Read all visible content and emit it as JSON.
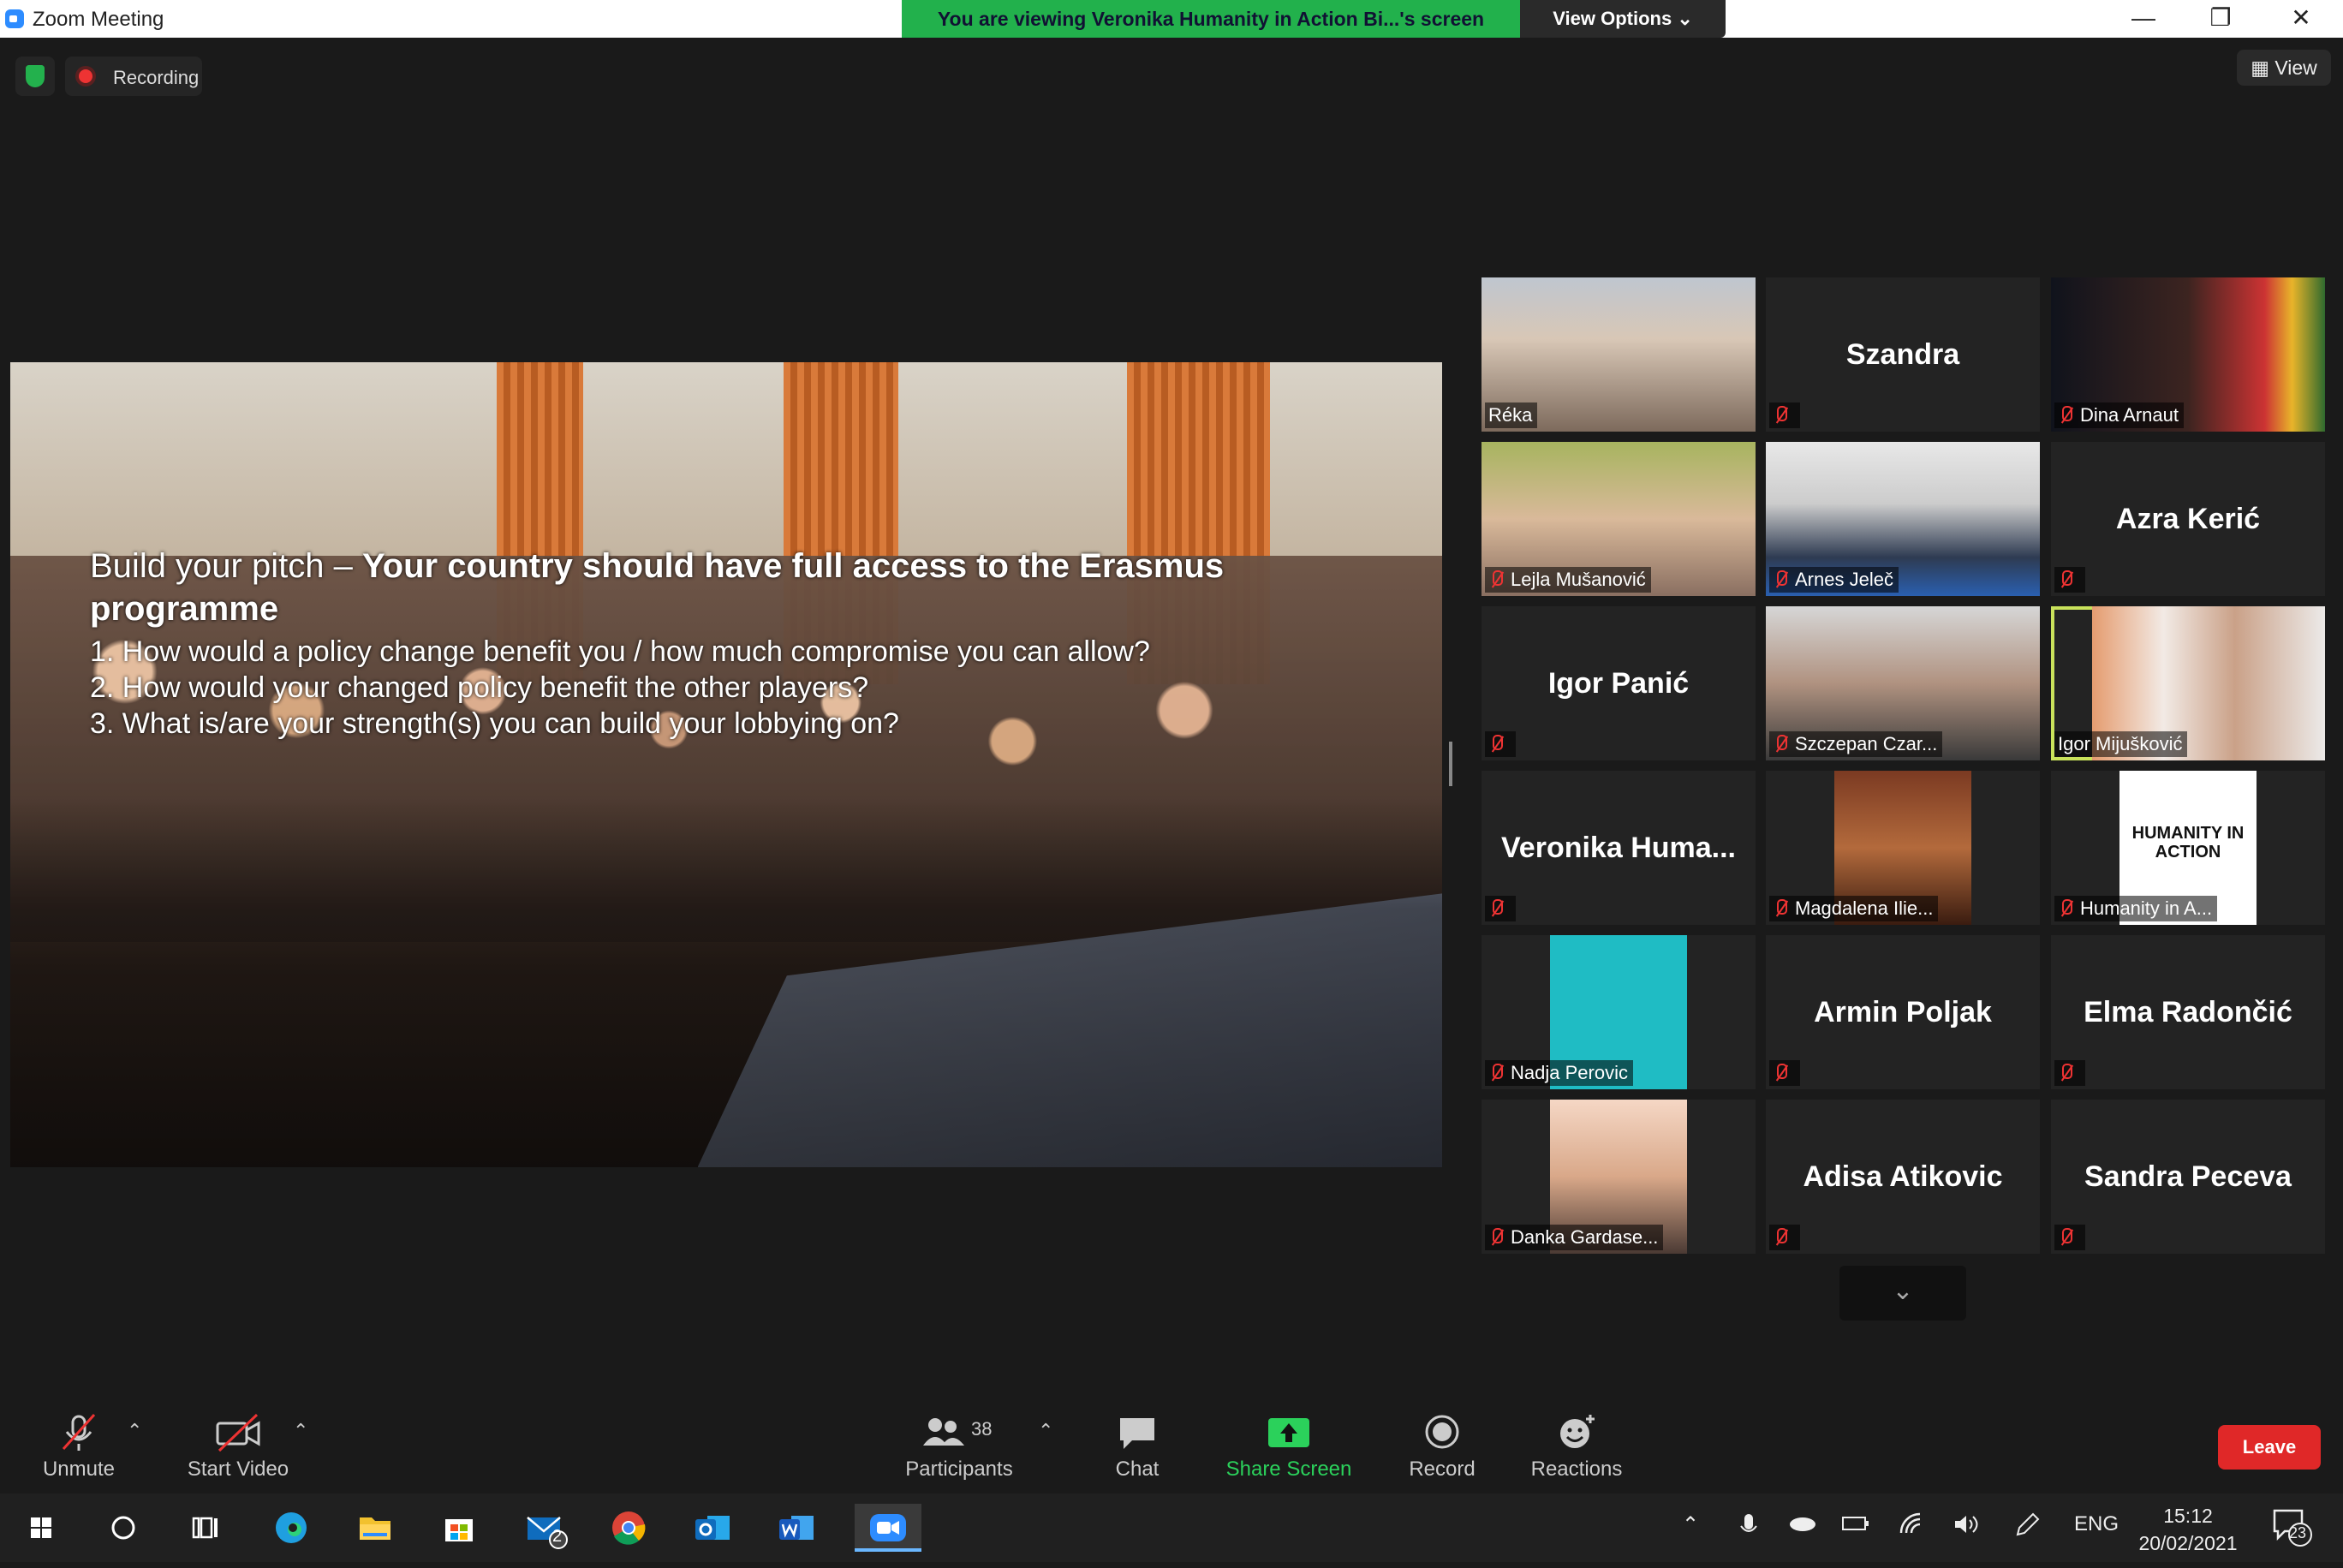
{
  "window": {
    "title": "Zoom Meeting"
  },
  "banner": {
    "text": "You are viewing Veronika Humanity in Action Bi...'s screen",
    "view_options": "View Options ⌄"
  },
  "window_controls": {
    "minimize": "—",
    "maximize": "❐",
    "close": "✕"
  },
  "status": {
    "recording": "Recording",
    "view": "View"
  },
  "slide": {
    "title_normal": "Build your pitch – ",
    "title_bold": "Your country should have full access to the Erasmus programme",
    "items": [
      "1.  How would a policy change benefit you / how much compromise you can allow?",
      "2.  How would your changed policy benefit the other players?",
      "3.  What is/are your strength(s) you can build your lobbying on?"
    ]
  },
  "participants": [
    {
      "label": "Réka",
      "bigname": "",
      "video": "person-blonde"
    },
    {
      "label": "",
      "bigname": "Szandra",
      "video": ""
    },
    {
      "label": "Dina Arnaut",
      "bigname": "",
      "video": "person-stage"
    },
    {
      "label": "Lejla Mušanović",
      "bigname": "",
      "video": "person-glasses"
    },
    {
      "label": "Arnes Jeleč",
      "bigname": "",
      "video": "person-dark"
    },
    {
      "label": "",
      "bigname": "Azra Kerić",
      "video": ""
    },
    {
      "label": "",
      "bigname": "Igor Panić",
      "video": ""
    },
    {
      "label": "Szczepan Czar...",
      "bigname": "",
      "video": "person-bald"
    },
    {
      "label": "Igor Mijušković",
      "bigname": "",
      "video": "person-beard"
    },
    {
      "label": "",
      "bigname": "Veronika  Huma...",
      "video": ""
    },
    {
      "label": "Magdalena Ilie...",
      "bigname": "",
      "video": "person-shelf"
    },
    {
      "label": "Humanity in A...",
      "bigname": "",
      "video": "logo"
    },
    {
      "label": "Nadja Perovic",
      "bigname": "",
      "video": "teal"
    },
    {
      "label": "",
      "bigname": "Armin Poljak",
      "video": ""
    },
    {
      "label": "",
      "bigname": "Elma Radončić",
      "video": ""
    },
    {
      "label": "Danka Gardase...",
      "bigname": "",
      "video": "person-woman"
    },
    {
      "label": "",
      "bigname": "Adisa Atikovic",
      "video": ""
    },
    {
      "label": "",
      "bigname": "Sandra Peceva",
      "video": ""
    }
  ],
  "logo_text": {
    "line1": "HUMANITY IN",
    "line2": "ACTION"
  },
  "toolbar": {
    "unmute": "Unmute",
    "start_video": "Start Video",
    "participants_count": "38",
    "participants": "Participants",
    "chat": "Chat",
    "share_screen": "Share Screen",
    "record": "Record",
    "reactions": "Reactions",
    "leave": "Leave"
  },
  "taskbar": {
    "mail_badge": "2",
    "language": "ENG",
    "time": "15:12",
    "date": "20/02/2021",
    "notifications": "23"
  },
  "colors": {
    "banner": "#22b14c",
    "active_speaker": "#c9e25b",
    "leave": "#e02828",
    "share": "#2bd15b"
  }
}
